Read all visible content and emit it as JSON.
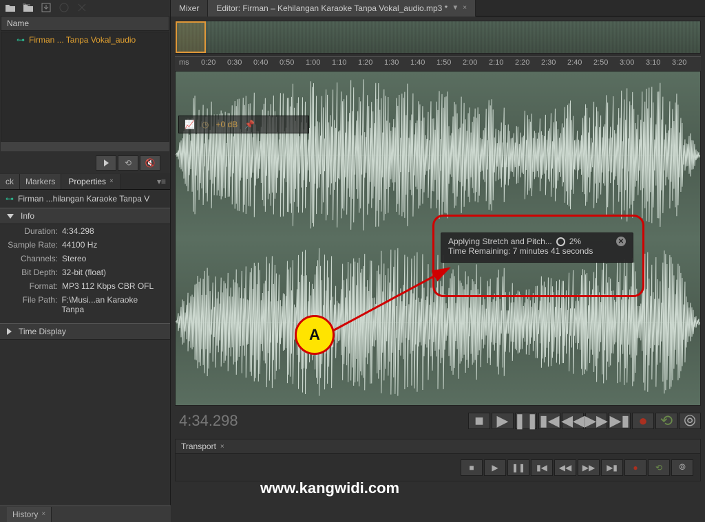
{
  "files_panel": {
    "header": "Name",
    "items": [
      "Firman ... Tanpa Vokal_audio"
    ]
  },
  "tabs": {
    "ck": "ck",
    "markers": "Markers",
    "properties": "Properties"
  },
  "selected_file": "Firman ...hilangan Karaoke Tanpa V",
  "info": {
    "header": "Info",
    "duration_lbl": "Duration:",
    "duration_val": "4:34.298",
    "sr_lbl": "Sample Rate:",
    "sr_val": "44100 Hz",
    "ch_lbl": "Channels:",
    "ch_val": "Stereo",
    "bd_lbl": "Bit Depth:",
    "bd_val": "32-bit (float)",
    "fmt_lbl": "Format:",
    "fmt_val": "MP3 112 Kbps CBR OFL",
    "fp_lbl": "File Path:",
    "fp_val": "F:\\Musi...an Karaoke Tanpa"
  },
  "time_display_header": "Time Display",
  "history_tab": "History",
  "editor": {
    "mixer_tab": "Mixer",
    "editor_tab": "Editor: Firman – Kehilangan Karaoke Tanpa Vokal_audio.mp3 *",
    "ruler_start": "ms",
    "ruler_ticks": [
      "0:20",
      "0:30",
      "0:40",
      "0:50",
      "1:00",
      "1:10",
      "1:20",
      "1:30",
      "1:40",
      "1:50",
      "2:00",
      "2:10",
      "2:20",
      "2:30",
      "2:40",
      "2:50",
      "3:00",
      "3:10",
      "3:20"
    ],
    "hud_db": "+0 dB",
    "timecode": "4:34.298"
  },
  "progress": {
    "label": "Applying Stretch and Pitch...",
    "percent": "2%",
    "remaining": "Time Remaining: 7 minutes 41 seconds"
  },
  "transport": {
    "header": "Transport"
  },
  "callout": {
    "label": "A"
  },
  "watermark": "www.kangwidi.com"
}
